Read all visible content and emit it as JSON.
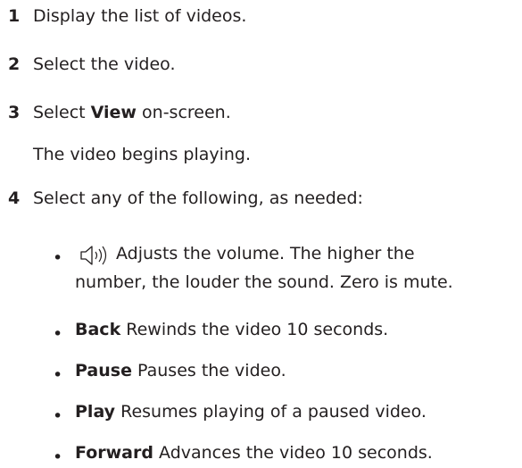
{
  "steps": [
    {
      "num": "1",
      "text": "Display the list of videos."
    },
    {
      "num": "2",
      "text": "Select the video."
    },
    {
      "num": "3",
      "pre": "Select ",
      "bold": "View",
      "post": " on-screen."
    },
    {
      "num": "4",
      "text": "Select any of the following, as needed:"
    }
  ],
  "step3_note": "The video begins playing.",
  "bullet_glyph": "•",
  "volume": {
    "icon": "speaker-volume-icon",
    "line1": "Adjusts the volume. The higher the",
    "line2": "number, the louder the sound. Zero is mute."
  },
  "controls": [
    {
      "label": "Back",
      "desc": " Rewinds the video 10 seconds."
    },
    {
      "label": "Pause",
      "desc": " Pauses the video."
    },
    {
      "label": "Play",
      "desc": " Resumes playing of a paused video."
    },
    {
      "label": "Forward",
      "desc": " Advances the video 10 seconds."
    }
  ]
}
